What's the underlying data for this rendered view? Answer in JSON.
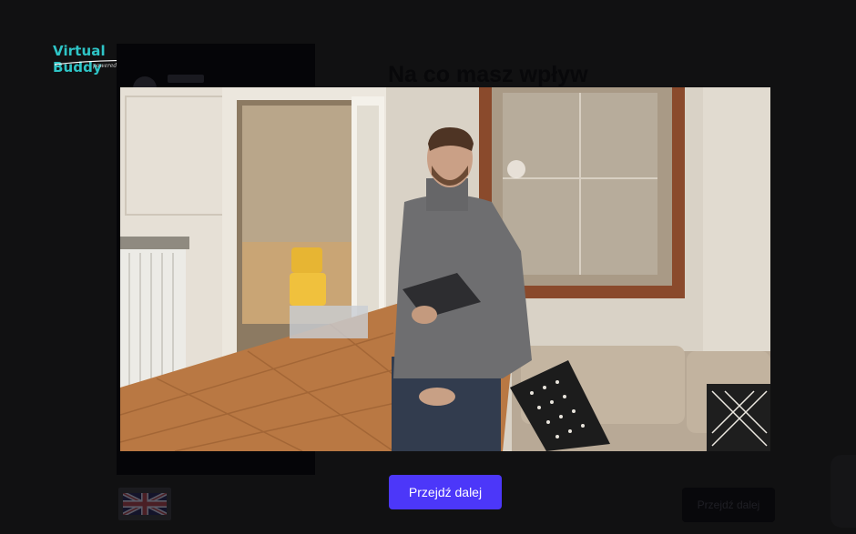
{
  "brand": {
    "title": "Virtual Buddy",
    "subtitle": "powered by InVentVR",
    "color": "#2ec4c6"
  },
  "background": {
    "heading": "Na co masz wpływ",
    "next_label": "Przejdź dalej",
    "language_flag": "uk-flag-icon"
  },
  "video": {
    "scene": "presenter-in-living-room"
  },
  "modal": {
    "continue_label": "Przejdź dalej",
    "accent": "#4c37f9"
  }
}
